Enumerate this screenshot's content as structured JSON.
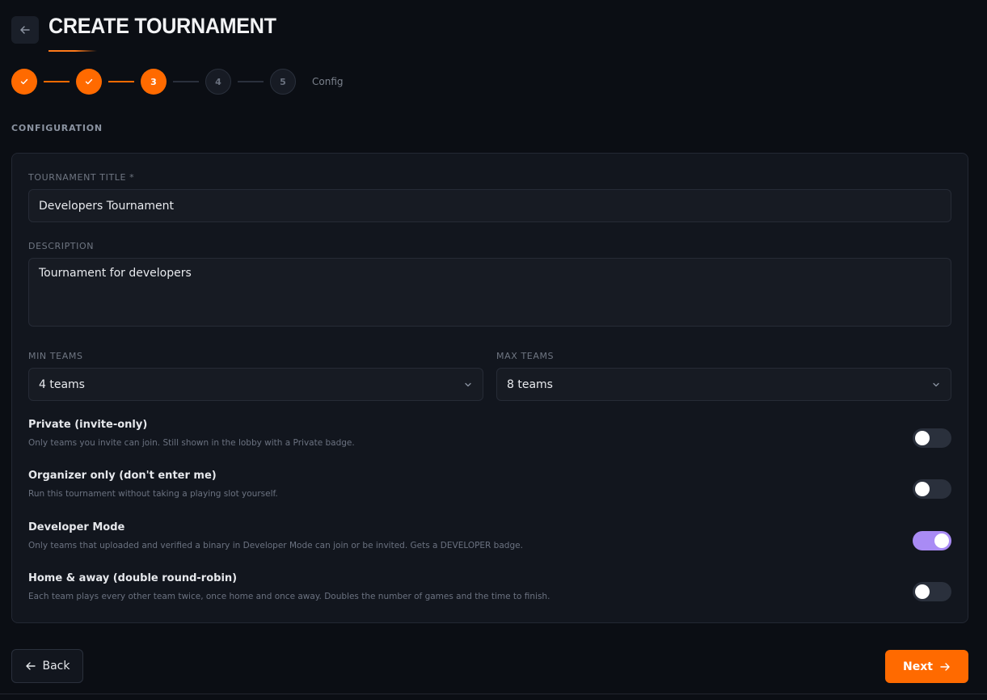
{
  "header": {
    "title": "CREATE TOURNAMENT"
  },
  "stepper": {
    "steps": [
      {
        "label": "",
        "state": "done"
      },
      {
        "label": "",
        "state": "done"
      },
      {
        "label": "3",
        "state": "current"
      },
      {
        "label": "4",
        "state": "todo"
      },
      {
        "label": "5",
        "state": "todo"
      }
    ],
    "caption": "Config"
  },
  "section": {
    "label": "CONFIGURATION"
  },
  "form": {
    "title_label": "TOURNAMENT TITLE *",
    "title_value": "Developers Tournament",
    "description_label": "DESCRIPTION",
    "description_value": "Tournament for developers",
    "min_teams_label": "MIN TEAMS",
    "min_teams_value": "4 teams",
    "max_teams_label": "MAX TEAMS",
    "max_teams_value": "8 teams"
  },
  "toggles": [
    {
      "title": "Private (invite-only)",
      "description": "Only teams you invite can join. Still shown in the lobby with a Private badge.",
      "on": false
    },
    {
      "title": "Organizer only (don't enter me)",
      "description": "Run this tournament without taking a playing slot yourself.",
      "on": false
    },
    {
      "title": "Developer Mode",
      "description": "Only teams that uploaded and verified a binary in Developer Mode can join or be invited. Gets a DEVELOPER badge.",
      "on": true
    },
    {
      "title": "Home & away (double round-robin)",
      "description": "Each team plays every other team twice, once home and once away. Doubles the number of games and the time to finish.",
      "on": false
    }
  ],
  "footer": {
    "back_label": "Back",
    "next_label": "Next"
  },
  "colors": {
    "accent": "#ff6a00",
    "toggle_on": "#a98bf5",
    "background": "#0b0e14",
    "card": "#12161e"
  },
  "icons": {
    "header_back": "arrow-left-icon",
    "step_done": "check-icon",
    "select": "chevron-down-icon",
    "back_button": "arrow-left-icon",
    "next_button": "arrow-right-icon"
  }
}
